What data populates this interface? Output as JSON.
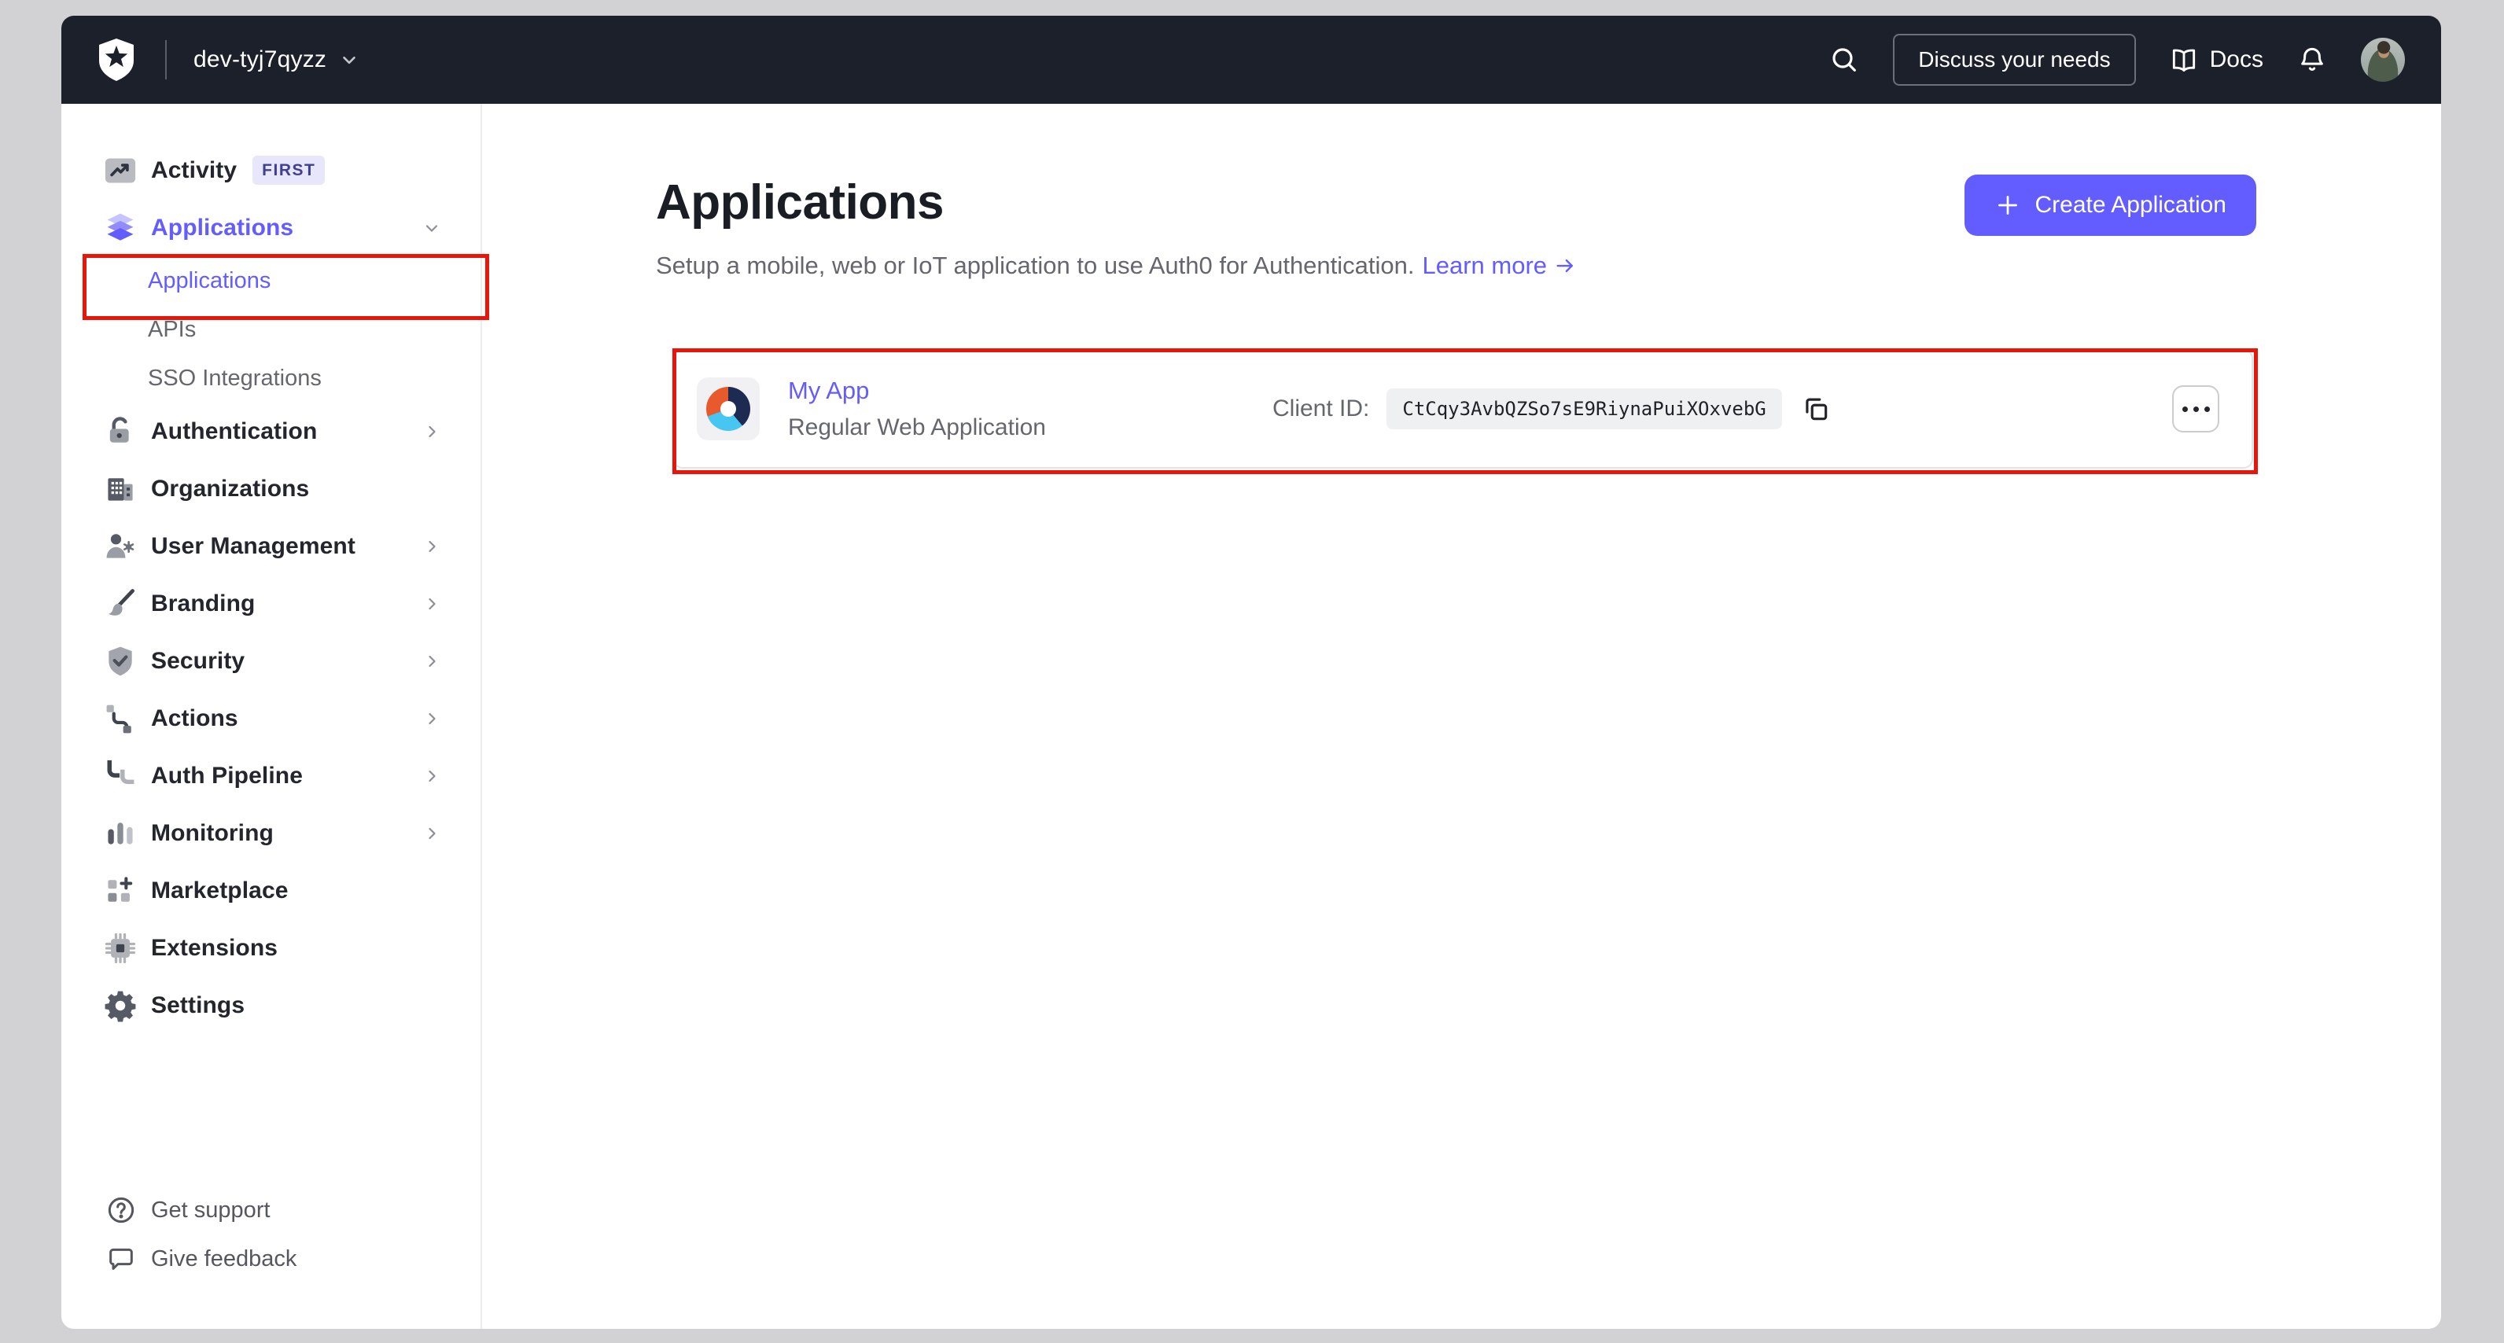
{
  "topbar": {
    "tenant": "dev-tyj7qyzz",
    "discuss_button": "Discuss your needs",
    "docs_label": "Docs"
  },
  "sidebar": {
    "items": [
      {
        "label": "Activity",
        "badge": "FIRST",
        "icon": "activity-chart"
      },
      {
        "label": "Applications",
        "icon": "layers",
        "chevron": "down",
        "accent": true
      },
      {
        "label": "Applications",
        "sub": true,
        "active": true
      },
      {
        "label": "APIs",
        "sub": true
      },
      {
        "label": "SSO Integrations",
        "sub": true
      },
      {
        "label": "Authentication",
        "icon": "lock",
        "chevron": "right"
      },
      {
        "label": "Organizations",
        "icon": "building"
      },
      {
        "label": "User Management",
        "icon": "user-gear",
        "chevron": "right"
      },
      {
        "label": "Branding",
        "icon": "paintbrush",
        "chevron": "right"
      },
      {
        "label": "Security",
        "icon": "shield-check",
        "chevron": "right"
      },
      {
        "label": "Actions",
        "icon": "flow",
        "chevron": "right"
      },
      {
        "label": "Auth Pipeline",
        "icon": "pipeline",
        "chevron": "right"
      },
      {
        "label": "Monitoring",
        "icon": "bar-chart",
        "chevron": "right"
      },
      {
        "label": "Marketplace",
        "icon": "grid-plus"
      },
      {
        "label": "Extensions",
        "icon": "chip"
      },
      {
        "label": "Settings",
        "icon": "gear"
      }
    ],
    "footer": [
      {
        "label": "Get support",
        "icon": "help-circle"
      },
      {
        "label": "Give feedback",
        "icon": "chat-bubble"
      }
    ]
  },
  "main": {
    "title": "Applications",
    "subtitle": "Setup a mobile, web or IoT application to use Auth0 for Authentication.",
    "learn_more": "Learn more",
    "create_button": "Create Application",
    "app": {
      "name": "My App",
      "type": "Regular Web Application",
      "client_id_label": "Client ID:",
      "client_id": "CtCqy3AvbQZSo7sE9RiynaPuiXOxvebG"
    }
  },
  "colors": {
    "accent": "#635dff",
    "annotation": "#e8150b",
    "navbar_bg": "#1c202a",
    "canvas_bg": "#d2d2d4",
    "logo_orange": "#e85a2b",
    "logo_navy": "#1d2a52",
    "logo_blue": "#47c6f1"
  }
}
